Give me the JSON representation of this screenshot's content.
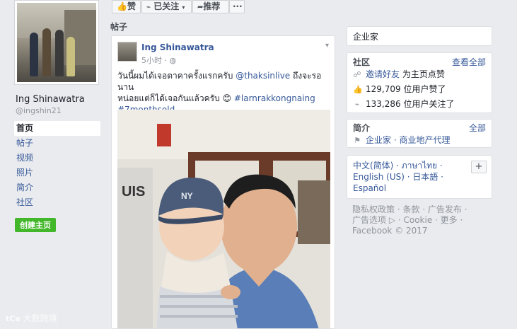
{
  "profile": {
    "name": "Ing Shinawatra",
    "handle": "@ingshin21",
    "nav": [
      "首页",
      "帖子",
      "视频",
      "照片",
      "简介",
      "社区"
    ],
    "create_page": "创建主页"
  },
  "action_bar": {
    "like": "赞",
    "following": "已关注",
    "share": "推荐",
    "more": "···"
  },
  "posts_section": {
    "title": "帖子"
  },
  "post": {
    "author": "Ing Shinawatra",
    "time": "5小时 · ",
    "text_line1_a": "วันนี้ผมได้เจอตาคาครั้งแรกครับ ",
    "text_mention": "@thaksinlive",
    "text_line1_b": " ถึงจะรอนาน",
    "text_line2_a": "หน่อยแต่ก็ได้เจอกันแล้วครับ 😊 ",
    "hashtag1": "#larnrakkongnaing",
    "hashtag2": "#7monthsold"
  },
  "sidebar": {
    "category": "企业家",
    "community": {
      "title": "社区",
      "see_all": "查看全部",
      "invite": "邀请好友",
      "invite_suffix": " 为主页点赞",
      "likes": "129,709 位用户赞了",
      "follows": "133,286 位用户关注了"
    },
    "about": {
      "title": "简介",
      "see_all": "全部",
      "categories": "企业家 · 商业地产代理"
    },
    "languages": {
      "line1": "中文(简体) · ภาษาไทย ·",
      "line2": "English (US) · 日本語 ·",
      "line3": "Español",
      "plus": "+"
    },
    "footer": {
      "line1": "隐私权政策 · 条款 · 广告发布 ·",
      "line2": "广告选项 ▷ · Cookie · 更多 ·",
      "line3": "Facebook © 2017"
    }
  },
  "watermark": "大数跨境"
}
